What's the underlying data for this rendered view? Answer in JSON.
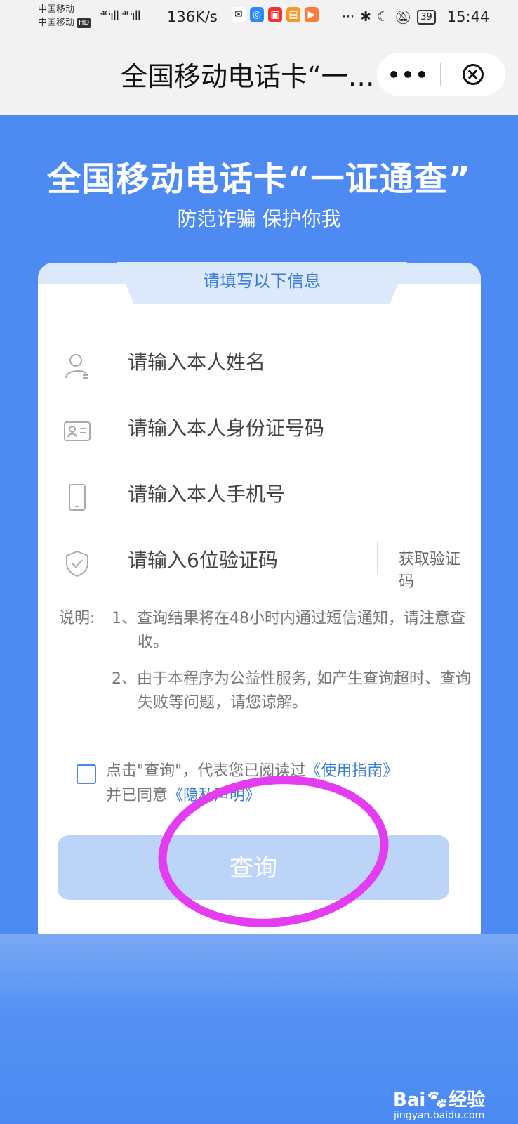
{
  "status_bar": {
    "carrier1": "中国移动",
    "carrier2": "中国移动",
    "hd": "HD",
    "signal": "⁴ᴳıll ⁴ᴳıll",
    "speed": "136K/s",
    "more": "···",
    "battery": "39",
    "time": "15:44"
  },
  "nav": {
    "title": "全国移动电话卡“一…",
    "more_icon": "more-icon",
    "close_icon": "close-icon"
  },
  "hero": {
    "title": "全国移动电话卡“一证通查”",
    "subtitle": "防范诈骗 保护你我"
  },
  "card": {
    "header": "请填写以下信息",
    "fields": [
      {
        "icon": "user-icon",
        "placeholder": "请输入本人姓名"
      },
      {
        "icon": "id-card-icon",
        "placeholder": "请输入本人身份证号码"
      },
      {
        "icon": "phone-icon",
        "placeholder": "请输入本人手机号"
      },
      {
        "icon": "shield-icon",
        "placeholder": "请输入6位验证码"
      }
    ],
    "get_code": "获取验证码",
    "notes_label": "说明:",
    "note1": "1、查询结果将在48小时内通过短信通知，请注意查收。",
    "note2": "2、由于本程序为公益性服务, 如产生查询超时、查询失败等问题，请您谅解。",
    "agree_prefix": "点击\"查询\"，代表您已阅读过",
    "guide_link": "《使用指南》",
    "agree_mid": "并已同意",
    "privacy_link": "《隐私声明》",
    "query_button": "查询"
  },
  "watermark": {
    "brand": "Bai",
    "brand2": "经验",
    "site": "jingyan.baidu.com"
  },
  "colors": {
    "page_bg": "#4d8bf2",
    "accent": "#3a7bd5",
    "button": "#bcd4f8",
    "annotation": "#e43cf0"
  }
}
